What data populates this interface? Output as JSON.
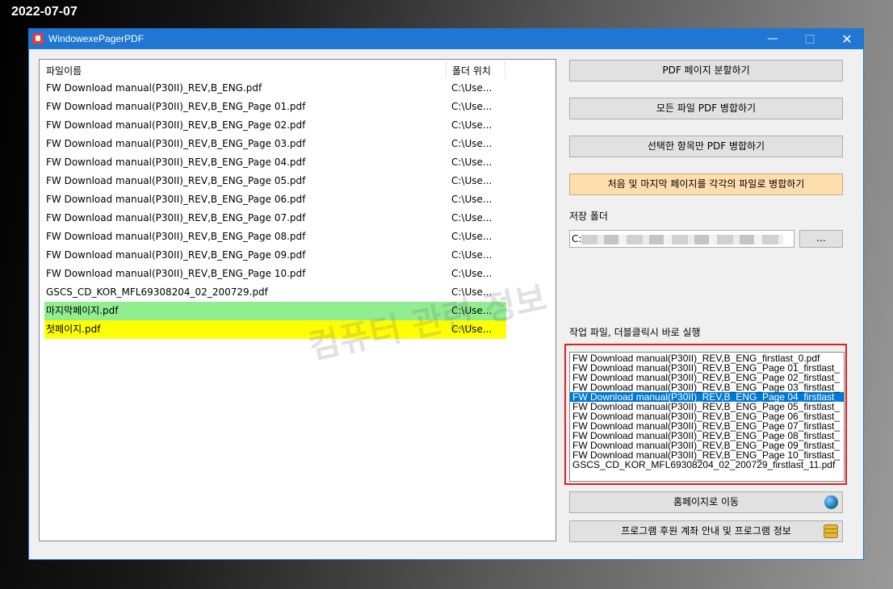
{
  "overlay": {
    "date": "2022-07-07"
  },
  "window": {
    "title": "WindowexePagerPDF"
  },
  "filelist": {
    "columns": [
      "파일이름",
      "폴더 위치"
    ],
    "rows": [
      {
        "name": "FW Download manual(P30II)_REV,B_ENG.pdf",
        "folder": "C:\\Use..."
      },
      {
        "name": "FW Download manual(P30II)_REV,B_ENG_Page 01.pdf",
        "folder": "C:\\Use..."
      },
      {
        "name": "FW Download manual(P30II)_REV,B_ENG_Page 02.pdf",
        "folder": "C:\\Use..."
      },
      {
        "name": "FW Download manual(P30II)_REV,B_ENG_Page 03.pdf",
        "folder": "C:\\Use..."
      },
      {
        "name": "FW Download manual(P30II)_REV,B_ENG_Page 04.pdf",
        "folder": "C:\\Use..."
      },
      {
        "name": "FW Download manual(P30II)_REV,B_ENG_Page 05.pdf",
        "folder": "C:\\Use..."
      },
      {
        "name": "FW Download manual(P30II)_REV,B_ENG_Page 06.pdf",
        "folder": "C:\\Use..."
      },
      {
        "name": "FW Download manual(P30II)_REV,B_ENG_Page 07.pdf",
        "folder": "C:\\Use..."
      },
      {
        "name": "FW Download manual(P30II)_REV,B_ENG_Page 08.pdf",
        "folder": "C:\\Use..."
      },
      {
        "name": "FW Download manual(P30II)_REV,B_ENG_Page 09.pdf",
        "folder": "C:\\Use..."
      },
      {
        "name": "FW Download manual(P30II)_REV,B_ENG_Page 10.pdf",
        "folder": "C:\\Use..."
      },
      {
        "name": "GSCS_CD_KOR_MFL69308204_02_200729.pdf",
        "folder": "C:\\Use..."
      },
      {
        "name": "마지막페이지.pdf",
        "folder": "C:\\Use...",
        "highlight": "#90ee90"
      },
      {
        "name": "첫페이지.pdf",
        "folder": "C:\\Use...",
        "highlight": "#ffff00"
      }
    ]
  },
  "watermark": "컴퓨터 관련 정보",
  "buttons": {
    "split": "PDF 페이지 분할하기",
    "merge_all": "모든 파일 PDF 병합하기",
    "merge_selected": "선택한 항목만 PDF 병합하기",
    "merge_first_last": "처음 및 마지막 페이지를 각각의 파일로 병합하기",
    "browse": "...",
    "homepage": "홈페이지로 이동",
    "donate_info": "프로그램 후원 계좌 안내 및 프로그램 정보"
  },
  "save_folder": {
    "label": "저장 폴더",
    "value": "C:"
  },
  "worklist": {
    "label": "작업 파일, 더블클릭시 바로 실행",
    "selected_index": 4,
    "items": [
      "FW Download manual(P30II)_REV,B_ENG_firstlast_0.pdf",
      "FW Download manual(P30II)_REV,B_ENG_Page 01_firstlast_",
      "FW Download manual(P30II)_REV,B_ENG_Page 02_firstlast_",
      "FW Download manual(P30II)_REV,B_ENG_Page 03_firstlast_",
      "FW Download manual(P30II)_REV,B_ENG_Page 04_firstlast_",
      "FW Download manual(P30II)_REV,B_ENG_Page 05_firstlast_",
      "FW Download manual(P30II)_REV,B_ENG_Page 06_firstlast_",
      "FW Download manual(P30II)_REV,B_ENG_Page 07_firstlast_",
      "FW Download manual(P30II)_REV,B_ENG_Page 08_firstlast_",
      "FW Download manual(P30II)_REV,B_ENG_Page 09_firstlast_",
      "FW Download manual(P30II)_REV,B_ENG_Page 10_firstlast_",
      "GSCS_CD_KOR_MFL69308204_02_200729_firstlast_11.pdf"
    ]
  },
  "icons": {
    "app": "pdf-app-icon",
    "globe": "globe-icon",
    "coins": "coins-icon"
  },
  "colors": {
    "titlebar": "#1f76d3",
    "selection": "#0078d7",
    "highlight_button": "#ffdead",
    "red_frame": "#e02020"
  }
}
